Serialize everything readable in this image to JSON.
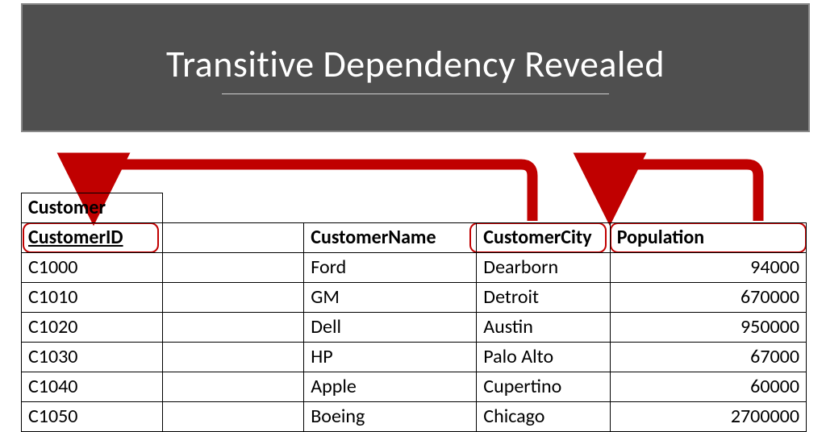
{
  "title": "Transitive Dependency Revealed",
  "table": {
    "caption": "Customer",
    "headers": [
      "CustomerID",
      "",
      "CustomerName",
      "CustomerCity",
      "Population"
    ],
    "rows": [
      {
        "id": "C1000",
        "blank": "",
        "name": "Ford",
        "city": "Dearborn",
        "pop": "94000"
      },
      {
        "id": "C1010",
        "blank": "",
        "name": "GM",
        "city": "Detroit",
        "pop": "670000"
      },
      {
        "id": "C1020",
        "blank": "",
        "name": "Dell",
        "city": "Austin",
        "pop": "950000"
      },
      {
        "id": "C1030",
        "blank": "",
        "name": "HP",
        "city": "Palo Alto",
        "pop": "67000"
      },
      {
        "id": "C1040",
        "blank": "",
        "name": "Apple",
        "city": "Cupertino",
        "pop": "60000"
      },
      {
        "id": "C1050",
        "blank": "",
        "name": "Boeing",
        "city": "Chicago",
        "pop": "2700000"
      }
    ]
  },
  "dependencies": [
    {
      "from": "CustomerCity",
      "to": "CustomerID"
    },
    {
      "from": "Population",
      "to": "CustomerCity"
    }
  ],
  "colors": {
    "arrow": "#c00000",
    "titlebg": "#4f4f4f"
  }
}
